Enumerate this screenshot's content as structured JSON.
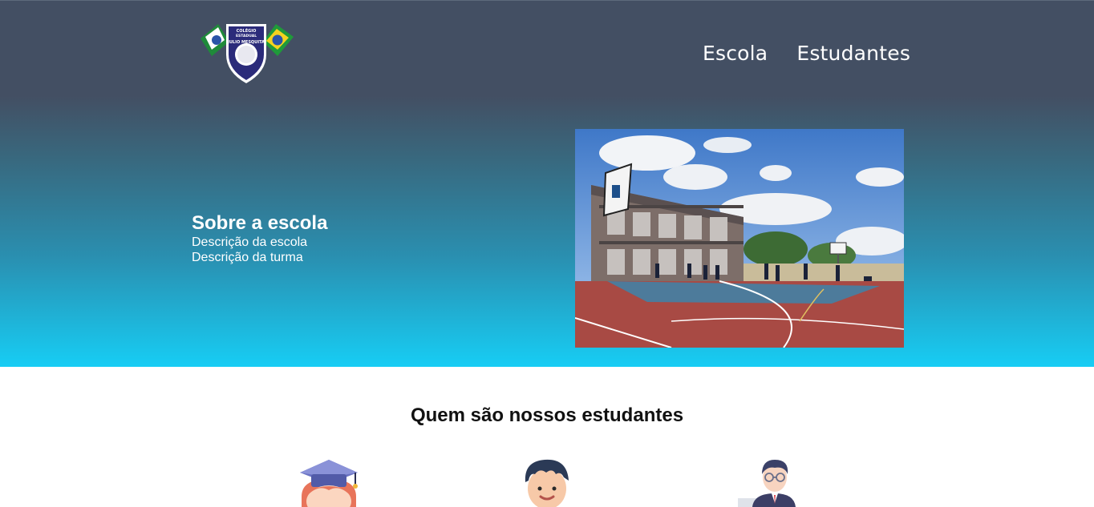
{
  "header": {
    "logo_icon": "school-crest-icon",
    "logo_text": [
      "COLÉGIO",
      "ESTADUAL",
      "JULIO MESQUITA"
    ],
    "nav": [
      {
        "label": "Escola"
      },
      {
        "label": "Estudantes"
      }
    ]
  },
  "about": {
    "title": "Sobre a escola",
    "lines": [
      "Descrição da escola",
      "Descrição da turma"
    ]
  },
  "hero_image": {
    "icon": "school-basketball-court-photo"
  },
  "students": {
    "title": "Quem são nossos estudantes",
    "avatars": [
      {
        "icon": "graduate-girl-icon"
      },
      {
        "icon": "boy-student-icon"
      },
      {
        "icon": "teacher-glasses-icon"
      }
    ]
  },
  "colors": {
    "hero_top": "#434f63",
    "hero_bottom": "#17cdf4",
    "text_light": "#ffffff",
    "text_dark": "#111111"
  }
}
